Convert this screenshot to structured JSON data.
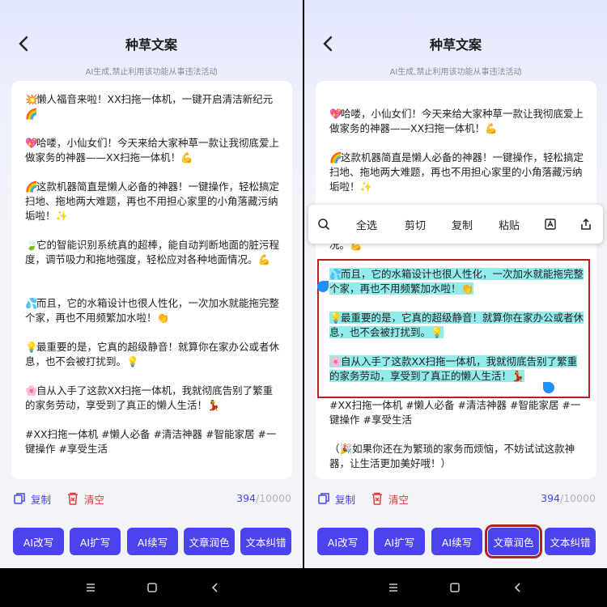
{
  "header": {
    "title": "种草文案",
    "subtitle": "AI生成,禁止利用该功能从事违法活动"
  },
  "paragraphs": [
    {
      "emoji": "💥",
      "text": "懒人福音来啦！XX扫拖一体机，一键开启清洁新纪元🌈"
    },
    {
      "emoji": "💖",
      "text": "哈喽，小仙女们！今天来给大家种草一款让我彻底爱上做家务的神器——XX扫拖一体机！💪"
    },
    {
      "emoji": "🌈",
      "text": "这款机器简直是懒人必备的神器！一键操作，轻松搞定扫地、拖地两大难题，再也不用担心家里的小角落藏污纳垢啦！✨"
    },
    {
      "emoji": "🍃",
      "text": "它的智能识别系统真的超棒，能自动判断地面的脏污程度，调节吸力和拖地强度，轻松应对各种地面情况。💪"
    },
    {
      "emoji": "💦",
      "text": "而且，它的水箱设计也很人性化，一次加水就能拖完整个家，再也不用频繁加水啦！👏"
    },
    {
      "emoji": "💡",
      "text": "最重要的是，它真的超级静音！就算你在家办公或者休息，也不会被打扰到。💡"
    },
    {
      "emoji": "🌸",
      "text": "自从入手了这款XX扫拖一体机，我就彻底告别了繁重的家务劳动，享受到了真正的懒人生活！💃"
    },
    {
      "emoji": "",
      "text": "#XX扫拖一体机 #懒人必备 #清洁神器 #智能家居 #一键操作 #享受生活"
    },
    {
      "emoji": "",
      "text": "（🎉如果你还在为繁琐的家务而烦恼，不妨试试这款神器，让生活更加美好哦！）"
    }
  ],
  "right_tail": "况。💪",
  "toolbar": {
    "copy_label": "复制",
    "clear_label": "清空",
    "count_current": "394",
    "count_max": "/10000"
  },
  "buttons": [
    "AI改写",
    "AI扩写",
    "AI续写",
    "文章润色",
    "文本纠错"
  ],
  "context_menu": {
    "items": [
      "全选",
      "剪切",
      "复制",
      "粘贴"
    ]
  },
  "colors": {
    "accent": "#4b43ee",
    "danger": "#e23b3b",
    "highlight": "#93ecec",
    "annotation": "#b22222"
  }
}
